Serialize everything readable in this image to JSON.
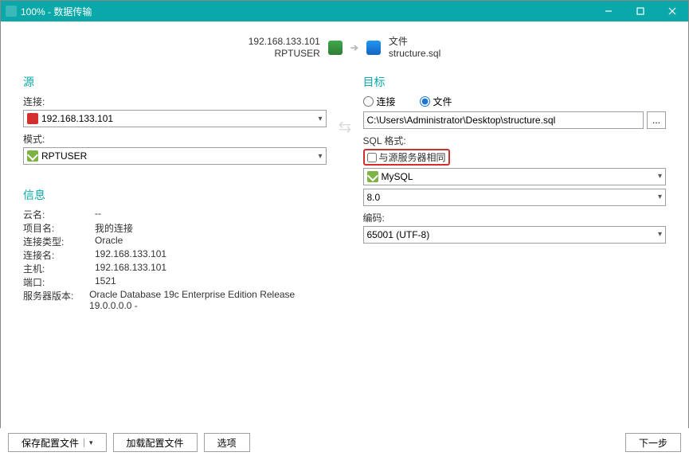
{
  "title": "100% - 数据传输",
  "header": {
    "source_line1": "192.168.133.101",
    "source_line2": "RPTUSER",
    "target_line1": "文件",
    "target_line2": "structure.sql"
  },
  "source": {
    "title": "源",
    "connection_label": "连接:",
    "connection_value": "192.168.133.101",
    "schema_label": "模式:",
    "schema_value": "RPTUSER"
  },
  "target": {
    "title": "目标",
    "radio_connection": "连接",
    "radio_file": "文件",
    "path_value": "C:\\Users\\Administrator\\Desktop\\structure.sql",
    "browse_label": "...",
    "sql_format_label": "SQL 格式:",
    "same_as_source_label": "与源服务器相同",
    "db_type_value": "MySQL",
    "version_value": "8.0",
    "encoding_label": "编码:",
    "encoding_value": "65001 (UTF-8)"
  },
  "info": {
    "title": "信息",
    "rows": [
      {
        "label": "云名:",
        "value": "--"
      },
      {
        "label": "项目名:",
        "value": "我的连接"
      },
      {
        "label": "连接类型:",
        "value": "Oracle"
      },
      {
        "label": "连接名:",
        "value": "192.168.133.101"
      },
      {
        "label": "主机:",
        "value": "192.168.133.101"
      },
      {
        "label": "端口:",
        "value": "1521"
      },
      {
        "label": "服务器版本:",
        "value": "Oracle Database 19c Enterprise Edition Release 19.0.0.0.0 -"
      }
    ]
  },
  "footer": {
    "save_profile": "保存配置文件",
    "load_profile": "加载配置文件",
    "options": "选项",
    "next": "下一步"
  }
}
